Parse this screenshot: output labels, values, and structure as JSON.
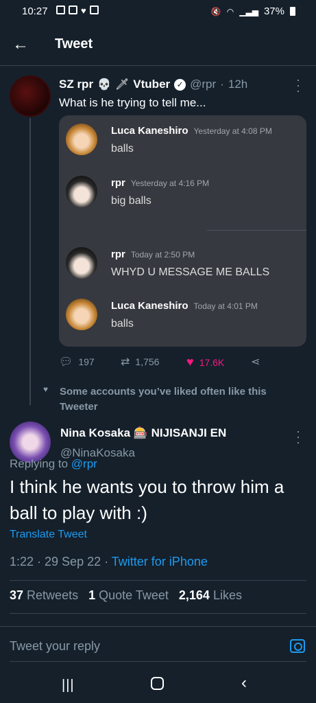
{
  "status_bar": {
    "time": "10:27",
    "battery": "37%"
  },
  "header": {
    "title": "Tweet"
  },
  "quoted_tweet": {
    "name": "SZ rpr",
    "badge_text": "Vtuber",
    "handle": "@rpr",
    "age": "12h",
    "text": "What is he trying to tell me...",
    "media_messages": [
      {
        "user": "Luca Kaneshiro",
        "timestamp": "Yesterday at 4:08 PM",
        "text": "balls"
      },
      {
        "user": "rpr",
        "timestamp": "Yesterday at 4:16 PM",
        "text": "big balls"
      },
      {
        "user": "rpr",
        "timestamp": "Today at 2:50 PM",
        "text": "WHYD U MESSAGE ME BALLS"
      },
      {
        "user": "Luca Kaneshiro",
        "timestamp": "Today at 4:01 PM",
        "text": "balls"
      }
    ],
    "replies": "197",
    "retweets": "1,756",
    "likes": "17.6K"
  },
  "social_context": "Some accounts you’ve liked often like this Tweeter",
  "main_tweet": {
    "name": "Nina Kosaka 🎰 NIJISANJI EN",
    "handle": "@NinaKosaka",
    "replying_label": "Replying to",
    "replying_handle": "@rpr",
    "text": "I think he wants you to throw him a ball to play with :)",
    "translate": "Translate Tweet",
    "time": "1:22 · 29 Sep 22 ·",
    "source": "Twitter for iPhone",
    "retweet_count": "37",
    "retweet_label": "Retweets",
    "quote_count": "1",
    "quote_label": "Quote Tweet",
    "like_count": "2,164",
    "like_label": "Likes"
  },
  "reply_box": {
    "placeholder": "Tweet your reply"
  },
  "colors": {
    "background": "#15202b",
    "accent": "#1d9bf0",
    "like": "#f91880",
    "muted": "#8899a6"
  }
}
